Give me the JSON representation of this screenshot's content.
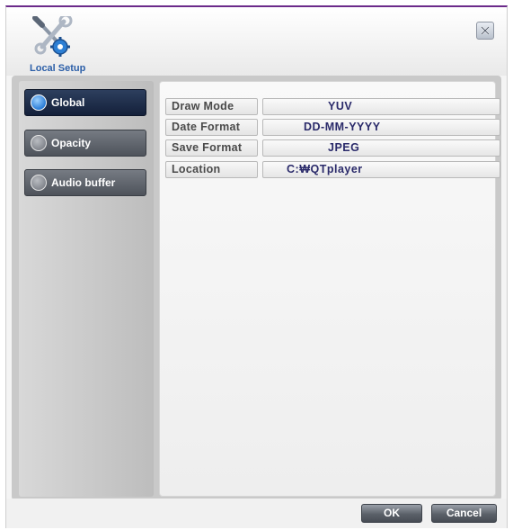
{
  "header": {
    "title": "Local Setup",
    "logo_icon": "wrench-screwdriver-gear-icon",
    "close_icon": "close-icon"
  },
  "sidebar": {
    "items": [
      {
        "label": "Global",
        "active": true
      },
      {
        "label": "Opacity",
        "active": false
      },
      {
        "label": "Audio buffer",
        "active": false
      }
    ]
  },
  "settings": {
    "rows": [
      {
        "label": "Draw Mode",
        "value": "YUV"
      },
      {
        "label": "Date Format",
        "value": "DD-MM-YYYY"
      },
      {
        "label": "Save Format",
        "value": "JPEG"
      },
      {
        "label": "Location",
        "value": "C:₩QTplayer"
      }
    ]
  },
  "footer": {
    "ok_label": "OK",
    "cancel_label": "Cancel"
  },
  "colors": {
    "active_nav": "#1b2a47",
    "inactive_nav": "#5f646c",
    "title_blue": "#2c5fa8",
    "value_text": "#2a2a6a"
  }
}
